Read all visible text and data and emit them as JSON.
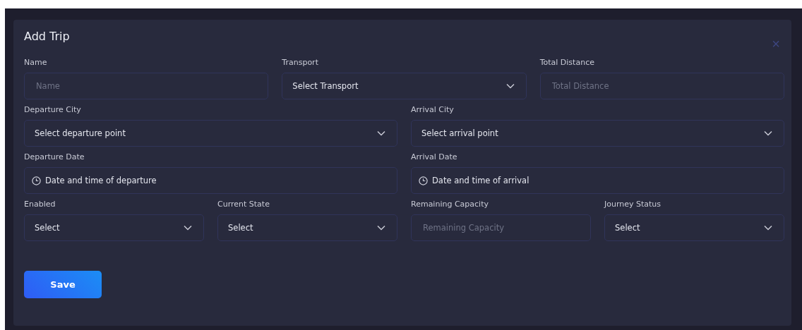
{
  "dialog": {
    "title": "Add Trip",
    "close": "×"
  },
  "rows": [
    [
      {
        "label": "Name",
        "kind": "text",
        "placeholder": "Name"
      },
      {
        "label": "Transport",
        "kind": "select",
        "value": "Select Transport"
      },
      {
        "label": "Total Distance",
        "kind": "text",
        "placeholder": "Total Distance"
      }
    ],
    [
      {
        "label": "Departure City",
        "kind": "select",
        "value": "Select departure point"
      },
      {
        "label": "Arrival City",
        "kind": "select",
        "value": "Select arrival point"
      }
    ],
    [
      {
        "label": "Departure Date",
        "kind": "datetime",
        "value": "Date and time of departure"
      },
      {
        "label": "Arrival Date",
        "kind": "datetime",
        "value": "Date and time of arrival"
      }
    ],
    [
      {
        "label": "Enabled",
        "kind": "select",
        "value": "Select"
      },
      {
        "label": "Current State",
        "kind": "select",
        "value": "Select"
      },
      {
        "label": "Remaining Capacity",
        "kind": "text",
        "placeholder": "Remaining Capacity"
      },
      {
        "label": "Journey Status",
        "kind": "select",
        "value": "Select"
      }
    ]
  ],
  "save_button": "Save"
}
